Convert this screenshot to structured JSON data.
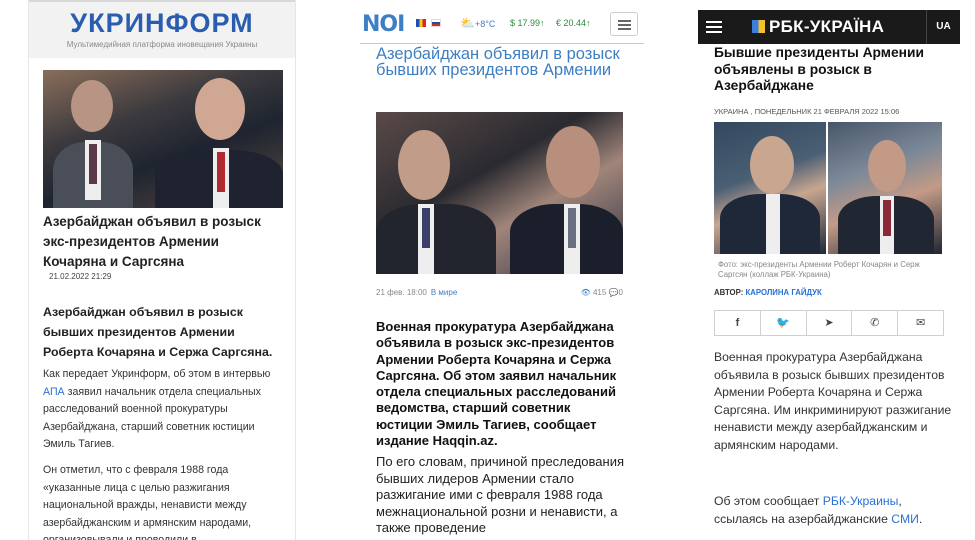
{
  "ukrinform": {
    "logo": "УКРИНФОРМ",
    "tagline": "Мультимедийная платформа иновещания Украины",
    "title": "Азербайджан объявил в розыск экс-президентов Армении Кочаряна и Саргсяна",
    "date": "21.02.2022 21:29",
    "lead": "Азербайджан объявил в розыск бывших президентов Армении Роберта Кочаряна и Сержа Саргсяна.",
    "p1_before": "Как передает Укринформ, об этом в интервью ",
    "p1_link": "АПА",
    "p1_after": " заявил начальник отдела специальных расследований военной прокуратуры Азербайджана, старший советник юстиции Эмиль Тагиев.",
    "p2": "Он отметил, что с февраля 1988 года «указанные лица с целью разжигания национальной вражды, ненависти между азербайджанским и армянским народами, организовывали и проводили в"
  },
  "noi": {
    "logo": "NOI",
    "weather": "+8°C",
    "usd": "$ 17.99",
    "eur": "€ 20.44",
    "title": "Азербайджан объявил в розыск бывших президентов Армении",
    "date": "21 фев. 18:00",
    "category": "В мире",
    "views": "415",
    "comments": "0",
    "lead": "Военная прокуратура Азербайджана объявила в розыск экс-президентов Армении Роберта Кочаряна и Сержа Саргсяна. Об этом заявил начальник отдела специальных расследований ведомства, старший советник юстиции Эмиль Тагиев, сообщает издание Haqqin.az.",
    "text": "По его словам, причиной преследования бывших лидеров Армении стало разжигание ими с февраля 1988 года межнациональной розни и ненависти, а также проведение"
  },
  "rbc": {
    "logo": "РБК-УКРАЇНА",
    "lang": "UA",
    "title": "Бывшие президенты Армении объявлены в розыск в Азербайджане",
    "subline": "УКРАИНА , ПОНЕДЕЛЬНИК 21 ФЕВРАЛЯ 2022 15:06",
    "caption": "Фото: экс-президенты Армении Роберт Кочарян и Серж Саргсян (коллаж РБК-Украина)",
    "author_label": "АВТОР: ",
    "author_name": "КАРОЛИНА ГАЙДУК",
    "share_icons": [
      "facebook-icon",
      "twitter-icon",
      "telegram-icon",
      "viber-icon",
      "email-icon"
    ],
    "p1": "Военная прокуратура Азербайджана объявила в розыск бывших президентов Армении Роберта Кочаряна и Сержа Саргсяна. Им инкриминируют разжигание ненависти между азербайджанским и армянским народами.",
    "p2_before": "Об этом сообщает ",
    "p2_link1": "РБК-Украины",
    "p2_mid": ", ссылаясь на азербайджанские ",
    "p2_link2": "СМИ",
    "p2_after": "."
  }
}
